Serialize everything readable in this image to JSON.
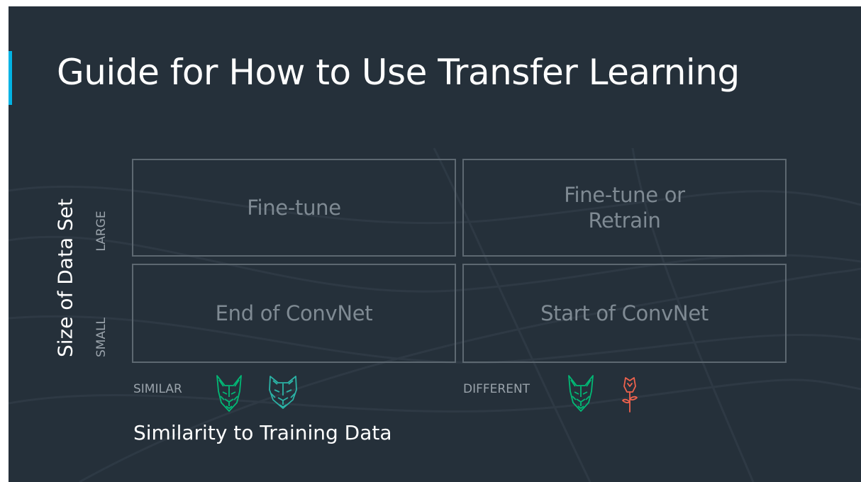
{
  "slide": {
    "title": "Guide for How to Use Transfer Learning",
    "accent_color": "#02b3e4",
    "background_color": "#25303a"
  },
  "y_axis": {
    "label": "Size of Data Set",
    "levels": [
      "LARGE",
      "SMALL"
    ]
  },
  "x_axis": {
    "label": "Similarity to Training Data",
    "levels": [
      "SIMILAR",
      "DIFFERENT"
    ]
  },
  "grid": {
    "large_similar": "Fine-tune",
    "large_different": "Fine-tune or\nRetrain",
    "small_similar": "End of ConvNet",
    "small_different": "Start of ConvNet"
  },
  "icons": {
    "similar": [
      "dog-icon",
      "wolf-icon"
    ],
    "different": [
      "dog-icon",
      "rose-icon"
    ],
    "animal_color": "#02b875",
    "wolf_color": "#2bb3a6",
    "rose_color": "#f0624d"
  }
}
